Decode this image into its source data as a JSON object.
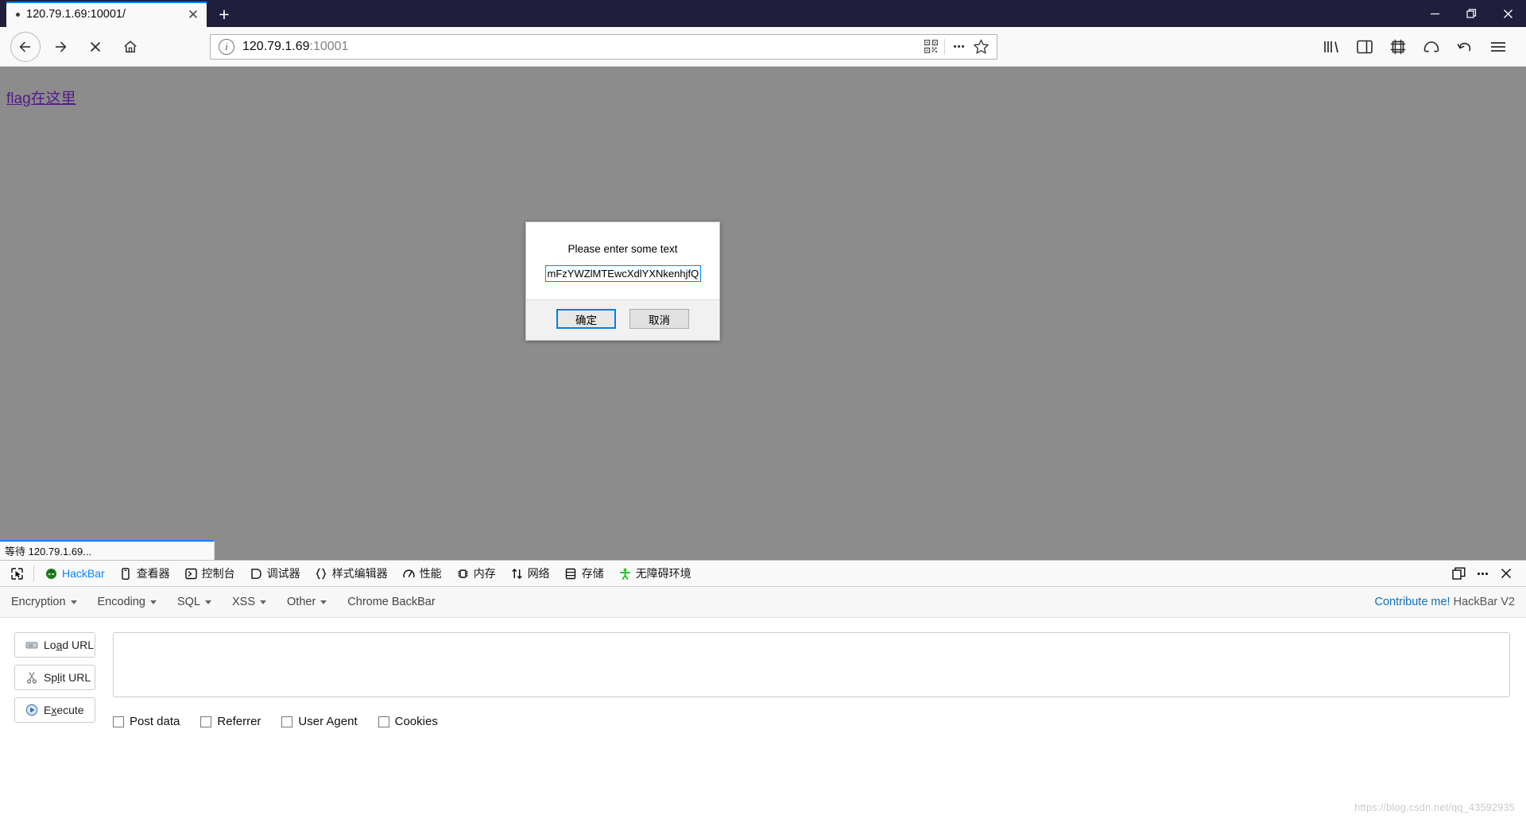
{
  "window": {
    "minimize_label": "Minimize",
    "restore_label": "Restore",
    "close_label": "Close"
  },
  "tab": {
    "title": "120.79.1.69:10001/",
    "close_glyph": "✕",
    "newtab_glyph": "+"
  },
  "nav": {
    "back_label": "Back",
    "forward_label": "Forward",
    "stop_glyph": "✕",
    "home_label": "Home"
  },
  "urlbar": {
    "info_glyph": "i",
    "host": "120.79.1.69",
    "port": ":10001",
    "full_url": "120.79.1.69:10001",
    "qr_icon": "qr-code-icon",
    "more_glyph": "•••",
    "star_glyph": "☆"
  },
  "toolbar_right": {
    "library_icon": "library-icon",
    "sidebar_icon": "sidebar-icon",
    "screenshot_icon": "screenshot-icon",
    "container_icon": "container-tabs-icon",
    "undo_icon": "undo-arrow-icon",
    "menu_icon": "hamburger-menu-icon"
  },
  "page": {
    "link_text": "flag在这里",
    "background_color": "#8c8c8c",
    "link_color": "#551a8b"
  },
  "dialog": {
    "message": "Please enter some text",
    "input_value": "mFzYWZlMTEwcXdlYXNkenhjfQ==",
    "input_placeholder": "",
    "ok_label": "确定",
    "cancel_label": "取消",
    "accent_color": "#0a7fd4"
  },
  "status": {
    "text": "等待 120.79.1.69..."
  },
  "devtools": {
    "picker_icon": "element-picker-icon",
    "tabs": [
      {
        "label": "HackBar",
        "icon": "hackbar-icon",
        "active": true
      },
      {
        "label": "查看器",
        "icon": "inspector-icon",
        "active": false
      },
      {
        "label": "控制台",
        "icon": "console-icon",
        "active": false
      },
      {
        "label": "调试器",
        "icon": "debugger-icon",
        "active": false
      },
      {
        "label": "样式编辑器",
        "icon": "style-editor-icon",
        "active": false
      },
      {
        "label": "性能",
        "icon": "performance-icon",
        "active": false
      },
      {
        "label": "内存",
        "icon": "memory-icon",
        "active": false
      },
      {
        "label": "网络",
        "icon": "network-icon",
        "active": false
      },
      {
        "label": "存储",
        "icon": "storage-icon",
        "active": false
      },
      {
        "label": "无障碍环境",
        "icon": "accessibility-icon",
        "active": false
      }
    ],
    "right_buttons": {
      "dock_icon": "dock-window-icon",
      "more_glyph": "…",
      "close_glyph": "✕"
    }
  },
  "hackbar": {
    "menus": [
      {
        "label": "Encryption",
        "has_caret": true
      },
      {
        "label": "Encoding",
        "has_caret": true
      },
      {
        "label": "SQL",
        "has_caret": true
      },
      {
        "label": "XSS",
        "has_caret": true
      },
      {
        "label": "Other",
        "has_caret": true
      },
      {
        "label": "Chrome BackBar",
        "has_caret": false
      }
    ],
    "contribute_link": "Contribute me!",
    "version_label": "HackBar V2",
    "buttons": [
      {
        "label": "Load URL",
        "icon": "load-url-icon"
      },
      {
        "label": "Split URL",
        "icon": "split-url-icon"
      },
      {
        "label": "Execute",
        "icon": "execute-icon"
      }
    ],
    "url_textarea_value": "",
    "url_textarea_placeholder": "",
    "checkboxes": [
      {
        "label": "Post data",
        "checked": false
      },
      {
        "label": "Referrer",
        "checked": false
      },
      {
        "label": "User Agent",
        "checked": false
      },
      {
        "label": "Cookies",
        "checked": false
      }
    ]
  },
  "watermark": {
    "text": "https://blog.csdn.net/qq_43592935"
  }
}
